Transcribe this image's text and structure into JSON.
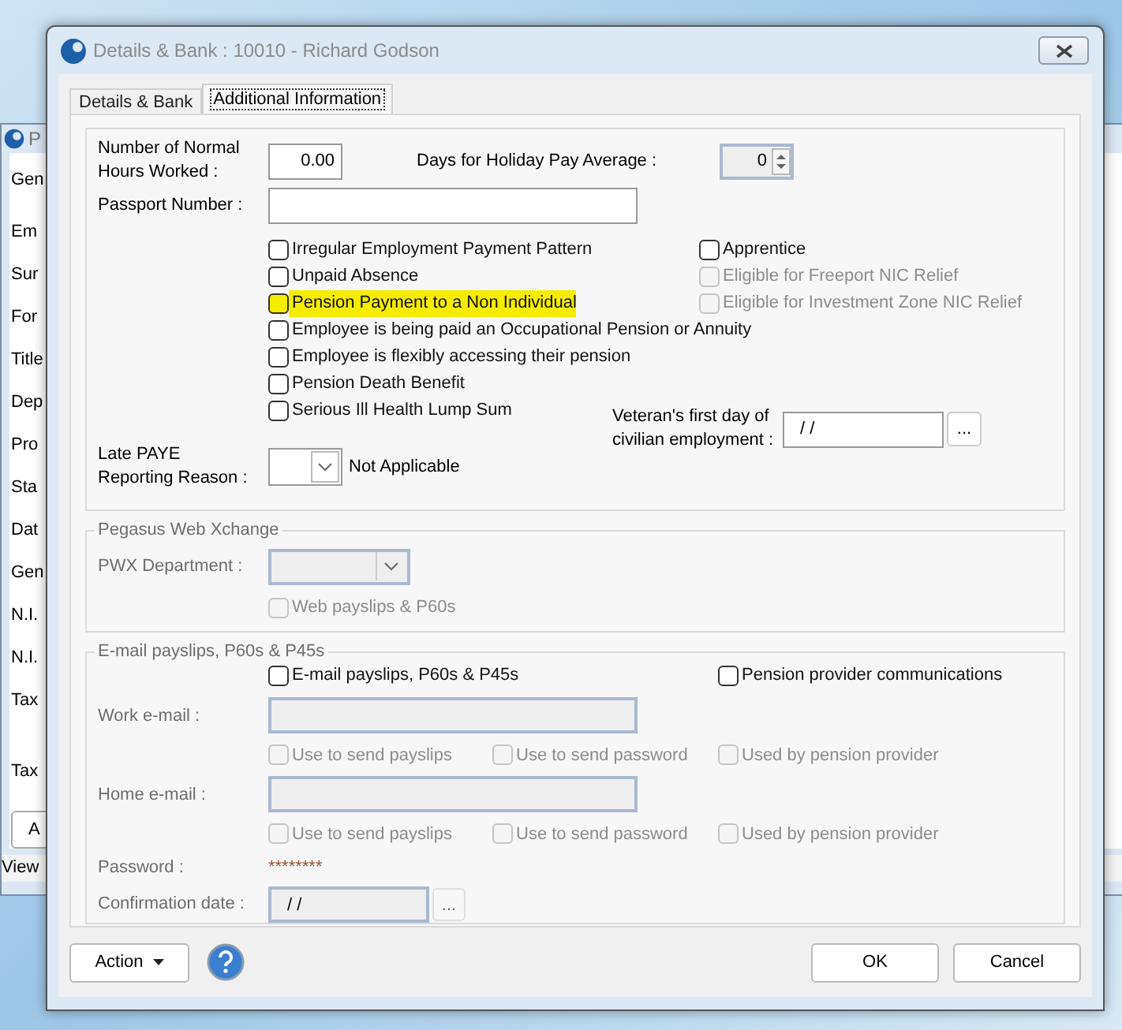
{
  "background_window": {
    "title": "P",
    "tab": "Gen",
    "labels": [
      "Em",
      "Sur",
      "For",
      "Title",
      "Dep",
      "Pro",
      "Sta",
      "Dat",
      "Gen",
      "N.I.",
      "N.I.",
      "Tax",
      "Tax"
    ],
    "button": "A",
    "menu_item": "View"
  },
  "window": {
    "title": "Details & Bank : 10010 - Richard Godson"
  },
  "tabs": [
    {
      "label": "Details & Bank",
      "selected": false
    },
    {
      "label": "Additional Information",
      "selected": true
    }
  ],
  "general": {
    "hours": {
      "label_lines": [
        "Number of Normal",
        "Hours Worked :"
      ],
      "value": "0.00"
    },
    "holiday": {
      "label": "Days for Holiday Pay Average :",
      "value": "0"
    },
    "passport": {
      "label": "Passport Number :"
    },
    "checks_left": [
      {
        "label": "Irregular Employment Payment Pattern",
        "checked": false,
        "disabled": false,
        "highlighted": false
      },
      {
        "label": "Unpaid Absence",
        "checked": false,
        "disabled": false,
        "highlighted": false
      },
      {
        "label": "Pension Payment to a Non Individual",
        "checked": false,
        "disabled": false,
        "highlighted": true
      },
      {
        "label": "Employee is being paid an Occupational Pension or Annuity",
        "checked": false,
        "disabled": false,
        "highlighted": false
      },
      {
        "label": "Employee is flexibly accessing their pension",
        "checked": false,
        "disabled": false,
        "highlighted": false
      },
      {
        "label": "Pension Death Benefit",
        "checked": false,
        "disabled": false,
        "highlighted": false
      },
      {
        "label": "Serious Ill Health Lump Sum",
        "checked": false,
        "disabled": false,
        "highlighted": false
      }
    ],
    "checks_right": [
      {
        "label": "Apprentice",
        "checked": false,
        "disabled": false,
        "highlighted": false
      },
      {
        "label": "Eligible for Freeport NIC Relief",
        "checked": false,
        "disabled": true,
        "highlighted": false
      },
      {
        "label": "Eligible for Investment Zone NIC Relief",
        "checked": false,
        "disabled": true,
        "highlighted": false
      }
    ],
    "veteran": {
      "label_lines": [
        "Veteran's first day of",
        "civilian employment :"
      ],
      "value": "/ /",
      "button": "..."
    },
    "late_paye": {
      "label_lines": [
        "Late PAYE",
        "Reporting Reason :"
      ],
      "value": "Not Applicable"
    }
  },
  "pwx": {
    "title": "Pegasus Web Xchange",
    "department": {
      "label": "PWX Department :",
      "disabled": true
    },
    "web_payslips": {
      "label": "Web payslips & P60s",
      "checked": false,
      "disabled": true,
      "highlighted": false
    }
  },
  "email": {
    "title": "E-mail payslips, P60s & P45s",
    "email_payslips": {
      "label": "E-mail payslips, P60s & P45s",
      "checked": false,
      "disabled": false,
      "highlighted": false
    },
    "pension_comms": {
      "label": "Pension provider communications",
      "checked": false,
      "disabled": false,
      "highlighted": false
    },
    "addresses": [
      {
        "label": "Work e-mail :",
        "disabled": true,
        "options": [
          {
            "label": "Use to send payslips",
            "checked": false,
            "disabled": true,
            "highlighted": false
          },
          {
            "label": "Use to send password",
            "checked": false,
            "disabled": true,
            "highlighted": false
          },
          {
            "label": "Used by pension provider",
            "checked": false,
            "disabled": true,
            "highlighted": false
          }
        ]
      },
      {
        "label": "Home e-mail :",
        "disabled": true,
        "options": [
          {
            "label": "Use to send payslips",
            "checked": false,
            "disabled": true,
            "highlighted": false
          },
          {
            "label": "Use to send password",
            "checked": false,
            "disabled": true,
            "highlighted": false
          },
          {
            "label": "Used by pension provider",
            "checked": false,
            "disabled": true,
            "highlighted": false
          }
        ]
      }
    ],
    "password": {
      "label": "Password :",
      "value": "********"
    },
    "confirmation": {
      "label": "Confirmation date :",
      "value": "/ /",
      "button": "...",
      "disabled": true
    }
  },
  "footer": {
    "action": "Action",
    "ok": "OK",
    "cancel": "Cancel"
  }
}
